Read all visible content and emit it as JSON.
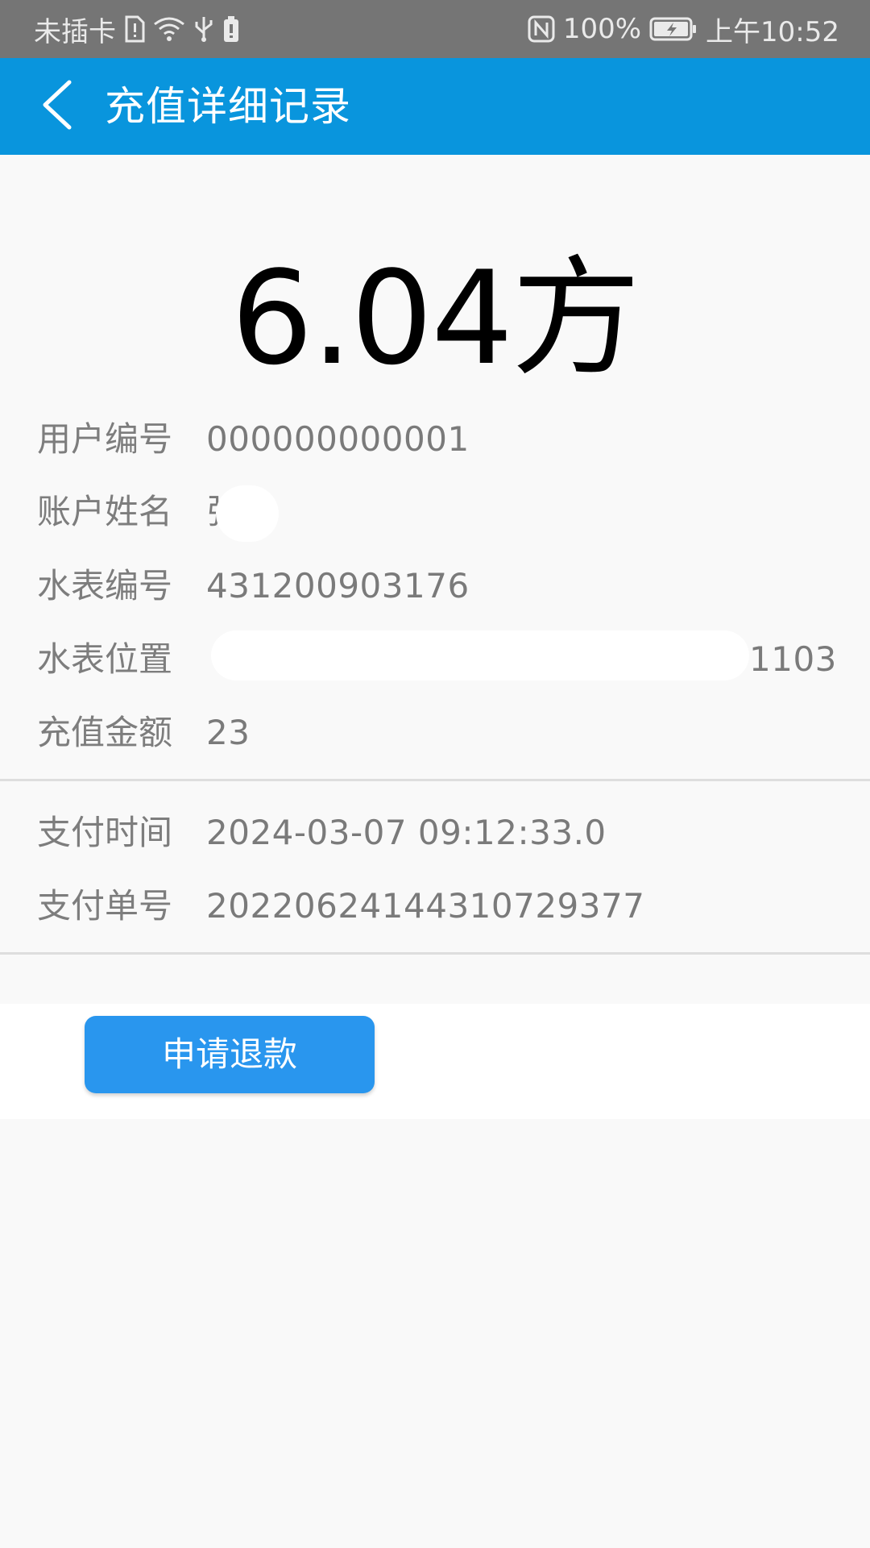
{
  "status_bar": {
    "carrier": "未插卡",
    "battery_percent": "100%",
    "time": "上午10:52",
    "icons_left": [
      "sim-alert-icon",
      "wifi-icon",
      "usb-icon",
      "battery-small-icon"
    ],
    "icons_right": [
      "nfc-icon",
      "battery-charging-icon"
    ]
  },
  "toolbar": {
    "title": "充值详细记录",
    "back_icon": "chevron-left-icon"
  },
  "amount": {
    "value": "6.04方"
  },
  "details": {
    "user_id": {
      "label": "用户编号",
      "value": "000000000001"
    },
    "account_name": {
      "label": "账户姓名",
      "value": "张"
    },
    "meter_id": {
      "label": "水表编号",
      "value": "431200903176"
    },
    "meter_location": {
      "label": "水表位置",
      "value": "1103"
    },
    "recharge_amount": {
      "label": "充值金额",
      "value": "23"
    }
  },
  "payment": {
    "pay_time": {
      "label": "支付时间",
      "value": "2024-03-07 09:12:33.0"
    },
    "order_no": {
      "label": "支付单号",
      "value": "20220624144310729377"
    }
  },
  "actions": {
    "refund_label": "申请退款"
  },
  "colors": {
    "status_bar_bg": "#757575",
    "toolbar_bg": "#0995dd",
    "button_bg": "#2996ee",
    "page_bg": "#f9f9f9"
  }
}
